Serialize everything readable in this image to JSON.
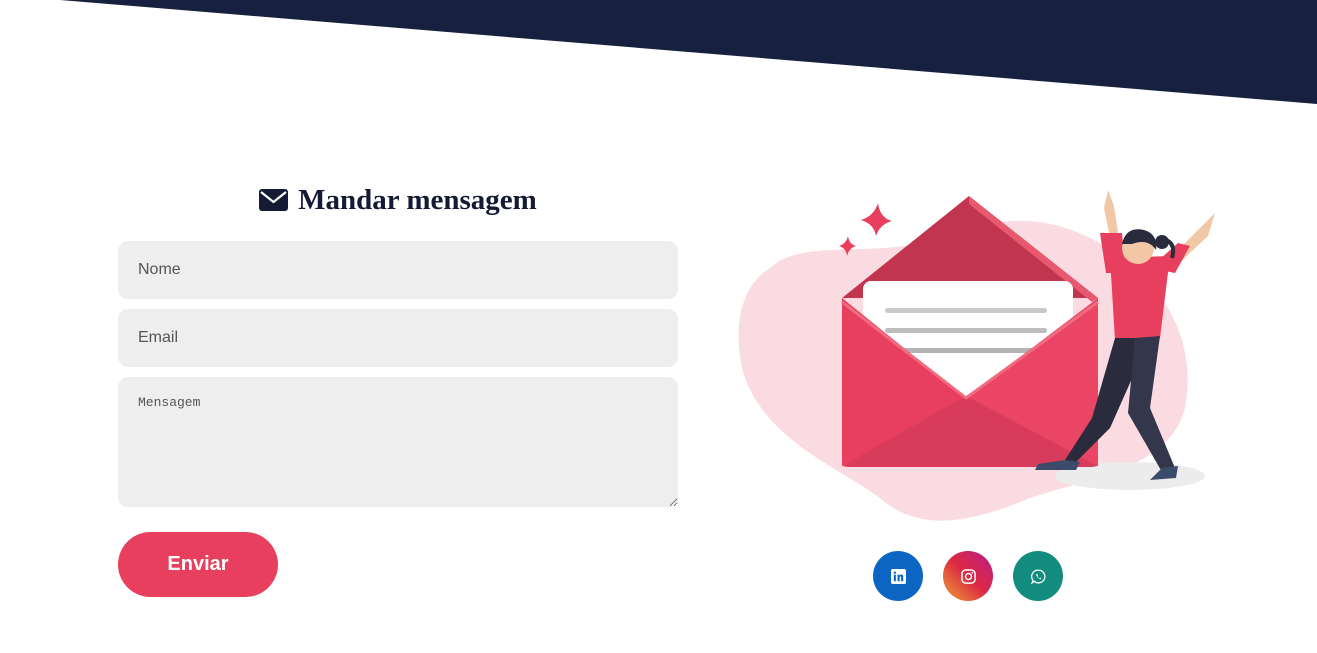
{
  "form": {
    "title": "Mandar mensagem",
    "name_placeholder": "Nome",
    "email_placeholder": "Email",
    "message_placeholder": "Mensagem",
    "submit_label": "Enviar"
  },
  "social": [
    {
      "icon": "linkedin-icon",
      "color": "#0a66c2"
    },
    {
      "icon": "instagram-icon",
      "color": "#e1306c"
    },
    {
      "icon": "whatsapp-icon",
      "color": "#128c7e"
    }
  ],
  "colors": {
    "navy": "#182040",
    "accent": "#e83f5e",
    "field_bg": "#eeeeee"
  }
}
